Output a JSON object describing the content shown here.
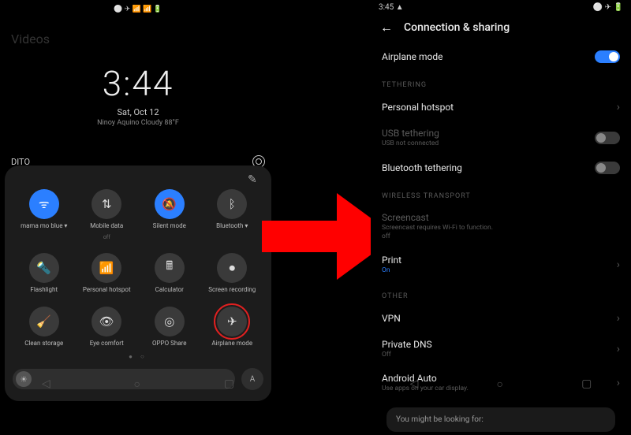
{
  "left": {
    "status_icons": "⚪ ✈ 📶 📶 🔋",
    "videos_label": "Videos",
    "time": "3:44",
    "date": "Sat, Oct 12",
    "weather": "Ninoy Aquino Cloudy 88°F",
    "carrier": "DITO",
    "edit_icon": "✎",
    "qs": [
      {
        "icon": "ᯤ",
        "label": "mama mo blue ▾",
        "sub": "",
        "on": true
      },
      {
        "icon": "⇅",
        "label": "Mobile data",
        "sub": "off",
        "on": false
      },
      {
        "icon": "🔕",
        "label": "Silent mode",
        "sub": "",
        "on": true
      },
      {
        "icon": "ᛒ",
        "label": "Bluetooth ▾",
        "sub": "",
        "on": false
      },
      {
        "icon": "🔦",
        "label": "Flashlight",
        "sub": "",
        "on": false
      },
      {
        "icon": "📶",
        "label": "Personal hotspot",
        "sub": "",
        "on": false
      },
      {
        "icon": "🖩",
        "label": "Calculator",
        "sub": "",
        "on": false
      },
      {
        "icon": "⏺",
        "label": "Screen recording",
        "sub": "",
        "on": false
      },
      {
        "icon": "🧹",
        "label": "Clean storage",
        "sub": "",
        "on": false
      },
      {
        "icon": "👁",
        "label": "Eye comfort",
        "sub": "",
        "on": false
      },
      {
        "icon": "◎",
        "label": "OPPO Share",
        "sub": "",
        "on": false
      },
      {
        "icon": "✈",
        "label": "Airplane mode",
        "sub": "",
        "on": false,
        "highlight": true
      }
    ],
    "brightness_icon": "☀",
    "auto_brightness": "A",
    "nav": {
      "back": "◁",
      "home": "○",
      "recent": "▢"
    }
  },
  "right": {
    "status_time": "3:45  ▲",
    "status_icons": "⚪ ✈ 🔋",
    "title": "Connection & sharing",
    "rows": {
      "airplane": {
        "label": "Airplane mode",
        "on": true
      },
      "section1": "TETHERING",
      "hotspot": {
        "label": "Personal hotspot"
      },
      "usb": {
        "label": "USB tethering",
        "sub": "USB not connected"
      },
      "bt_tether": {
        "label": "Bluetooth tethering",
        "on": false
      },
      "section2": "WIRELESS TRANSPORT",
      "screencast": {
        "label": "Screencast",
        "sub": "Screencast requires Wi-Fi to function.",
        "sub2": "off"
      },
      "print": {
        "label": "Print",
        "value": "On"
      },
      "section3": "OTHER",
      "vpn": {
        "label": "VPN"
      },
      "dns": {
        "label": "Private DNS",
        "value": "Off"
      },
      "aauto": {
        "label": "Android Auto",
        "sub": "Use apps on your car display."
      }
    },
    "suggest": "You might be looking for:"
  }
}
